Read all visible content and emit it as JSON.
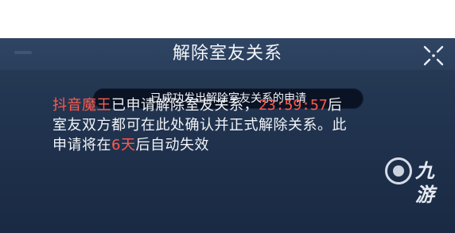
{
  "dialog": {
    "title": "解除室友关系",
    "notice": "已成功发出解除室友关系的申请",
    "message": {
      "requester": "抖音魔王",
      "part1": "已申请解除室友关系，",
      "timer": "23:59:57",
      "part2": "后室友双方都可在此处确认并正式解除关系。此申请将在",
      "days": "6天",
      "part3": "后自动失效"
    }
  },
  "watermark": {
    "text": "九游"
  },
  "colors": {
    "panel_bg": "#223550",
    "highlight": "#ff5a4e",
    "notice_bg": "#0a1323",
    "text": "#f2f4f8"
  }
}
